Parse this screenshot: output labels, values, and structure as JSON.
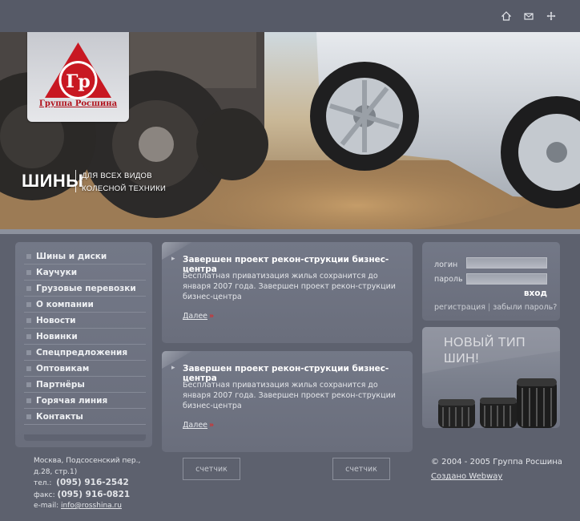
{
  "header": {
    "icons": [
      "home-icon",
      "mail-icon",
      "sitemap-icon"
    ]
  },
  "logo": {
    "monogram": "Гр",
    "caption": "Группа Росшина"
  },
  "hero": {
    "title": "ШИНЫ",
    "subtitle_line1": "ДЛЯ ВСЕХ ВИДОВ",
    "subtitle_line2": "КОЛЕСНОЙ ТЕХНИКИ"
  },
  "nav": {
    "items": [
      {
        "label": "Шины и диски"
      },
      {
        "label": "Каучуки"
      },
      {
        "label": "Грузовые перевозки"
      },
      {
        "label": "О компании"
      },
      {
        "label": "Новости"
      },
      {
        "label": "Новинки"
      },
      {
        "label": "Спецпредложения"
      },
      {
        "label": "Оптовикам"
      },
      {
        "label": "Партнёры"
      },
      {
        "label": "Горячая линия"
      },
      {
        "label": "Контакты"
      }
    ]
  },
  "news": [
    {
      "title": "Завершен проект рекон-струкции бизнес-центра",
      "text": "Бесплатная приватизация жилья сохранится до января 2007 года. Завершен проект рекон-струкции бизнес-центра",
      "more": "Далее",
      "arrow": "»"
    },
    {
      "title": "Завершен проект рекон-струкции бизнес-центра",
      "text": "Бесплатная приватизация жилья сохранится до января 2007 года. Завершен проект рекон-струкции бизнес-центра",
      "more": "Далее",
      "arrow": "»"
    }
  ],
  "login": {
    "login_label": "логин",
    "password_label": "пароль",
    "submit": "вход",
    "register": "регистрация",
    "separator": "|",
    "forgot": "забыли пароль?"
  },
  "promo": {
    "line1": "НОВЫЙ ТИП",
    "line2": "ШИН!"
  },
  "footer": {
    "address_line1": "Москва, Подсосенский пер.,",
    "address_line2": "д.28, стр.1)",
    "phone_label": "тел.:",
    "phone": "(095) 916-2542",
    "fax_label": "факс:",
    "fax": "(095) 916-0821",
    "email_label": "e-mail:",
    "email": "info@rosshina.ru",
    "counter1": "счетчик",
    "counter2": "счетчик",
    "copyright": "© 2004 - 2005  Группа Росшина",
    "credit": "Создано Webway"
  },
  "colors": {
    "background": "#5d616e",
    "panel": "#737887",
    "logo_red": "#b0101a",
    "accent_arrow": "#d33030"
  }
}
